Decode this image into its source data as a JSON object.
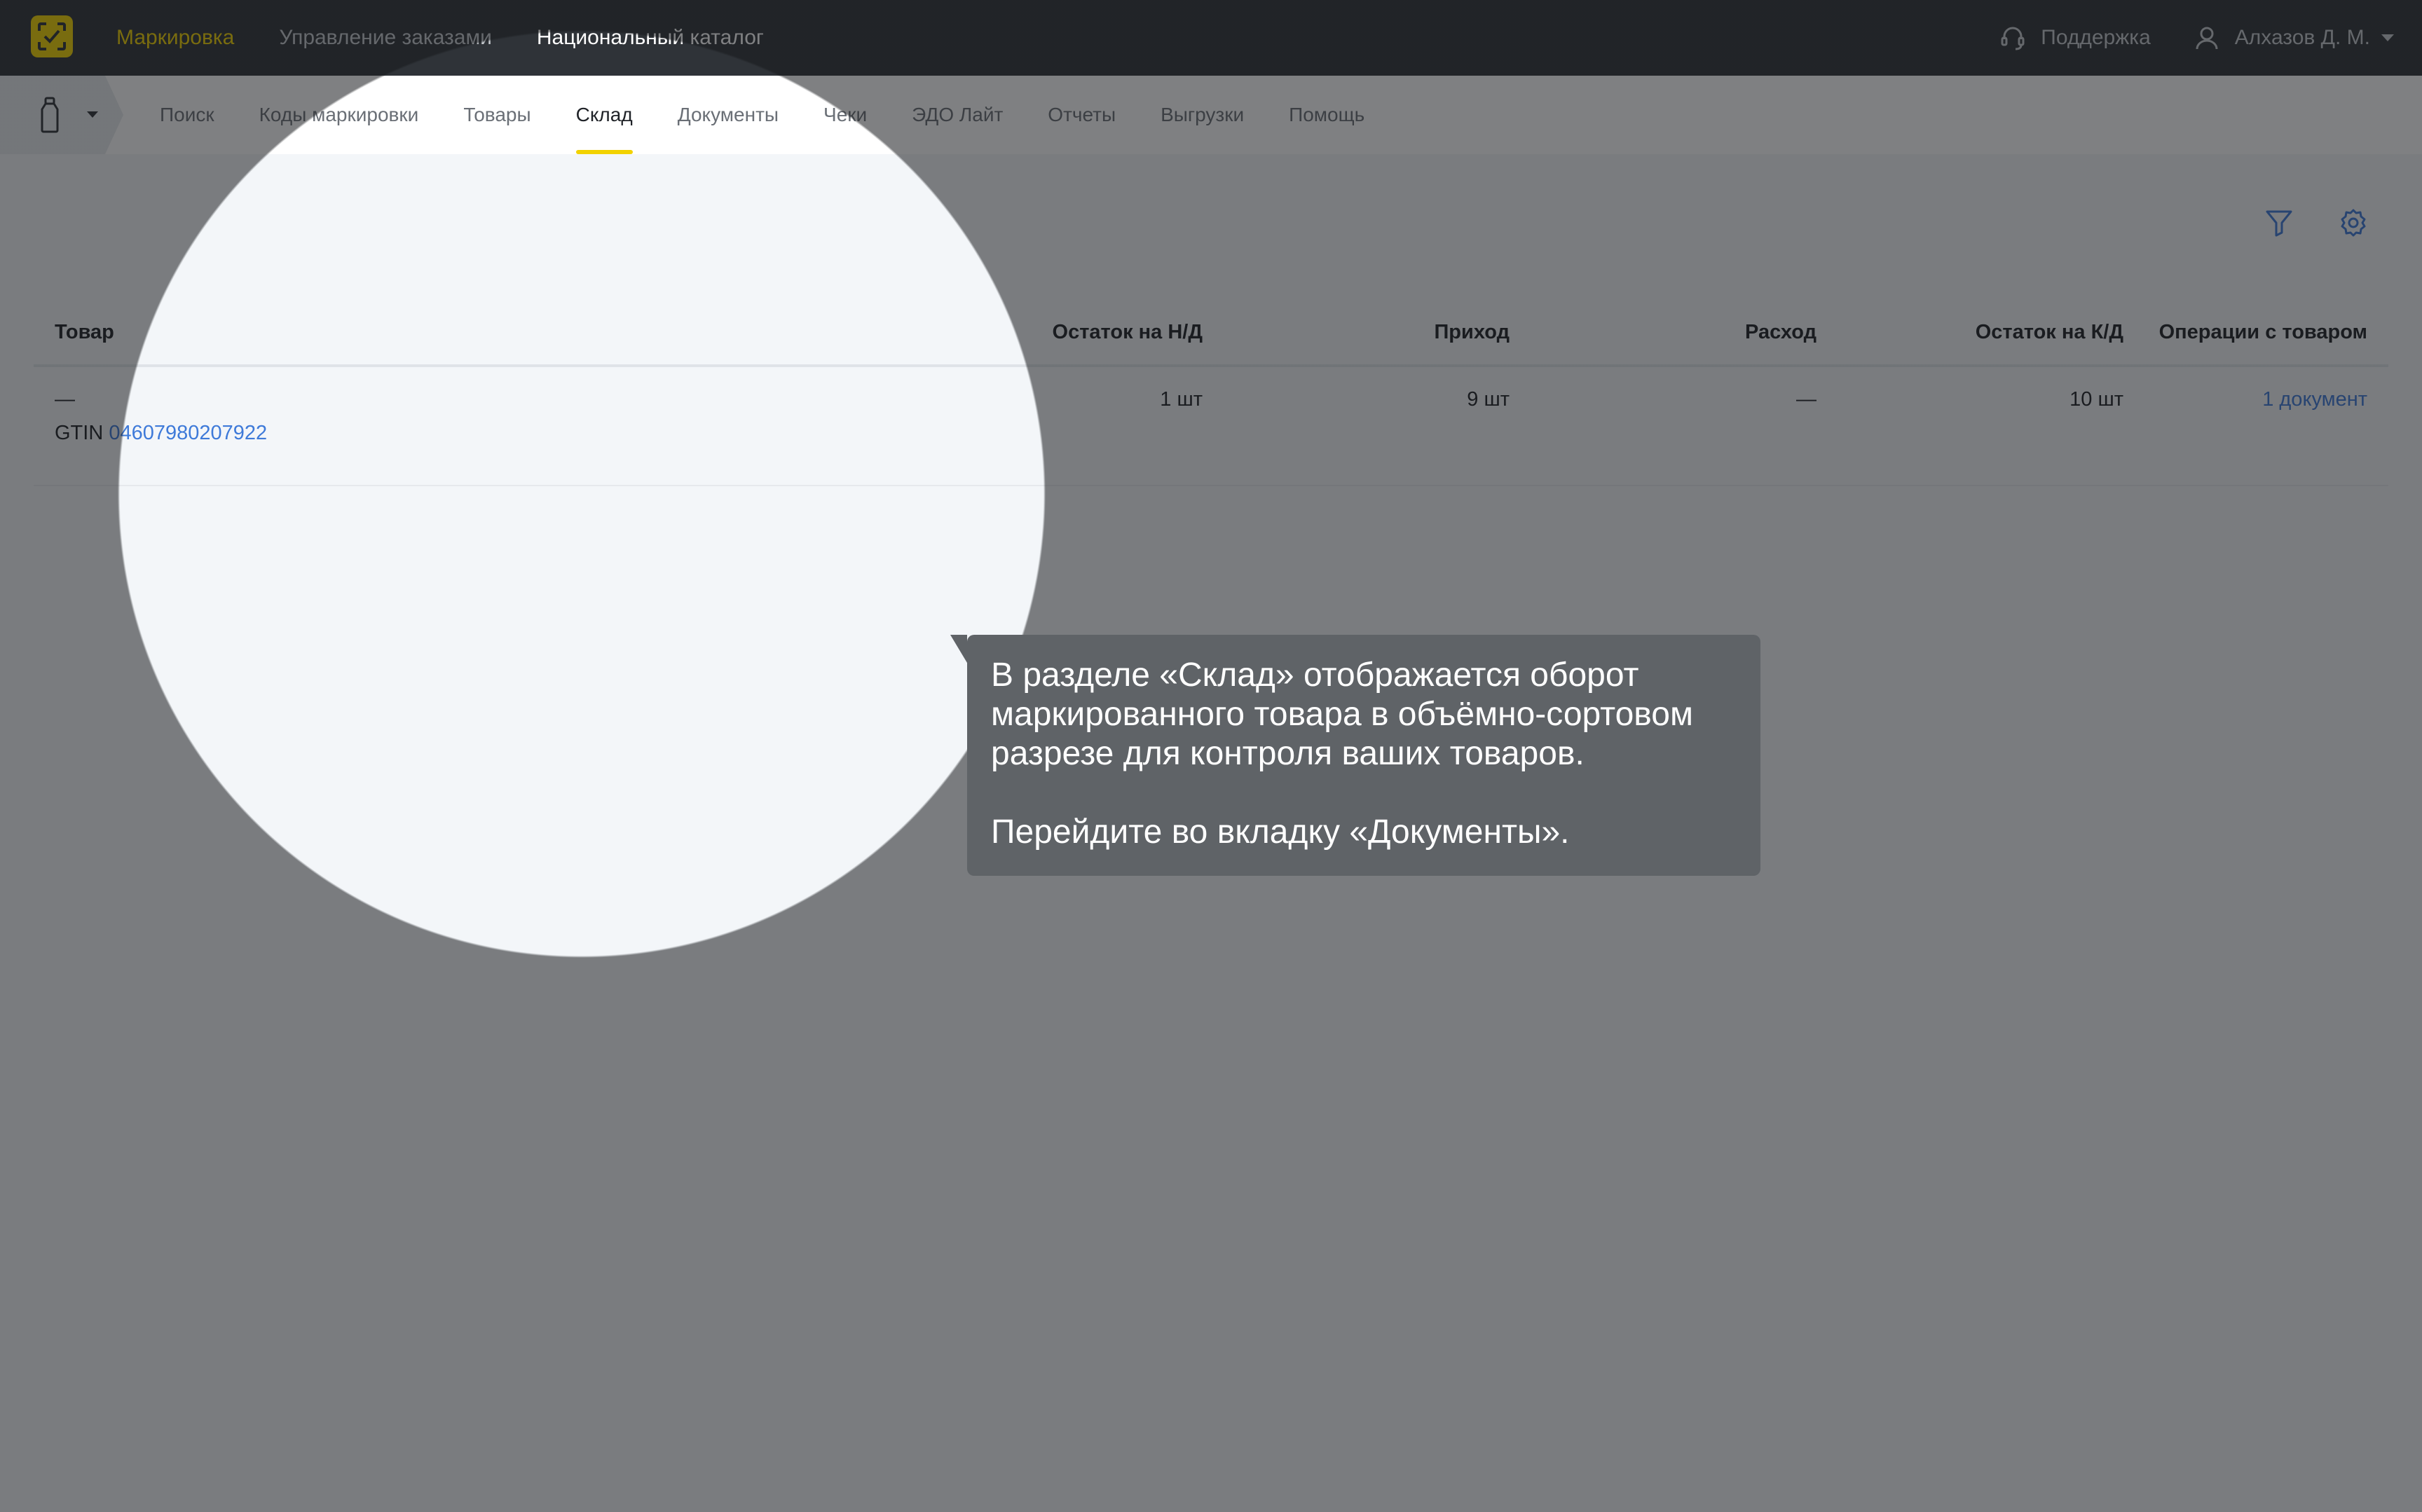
{
  "topbar": {
    "nav": [
      {
        "label": "Маркировка",
        "state": "active"
      },
      {
        "label": "Управление заказами",
        "state": "muted"
      },
      {
        "label": "Национальный каталог",
        "state": "bright"
      }
    ],
    "support_label": "Поддержка",
    "user_label": "Алхазов Д. М."
  },
  "subnav": {
    "tabs": [
      {
        "label": "Поиск"
      },
      {
        "label": "Коды маркировки"
      },
      {
        "label": "Товары"
      },
      {
        "label": "Склад"
      },
      {
        "label": "Документы"
      },
      {
        "label": "Чеки"
      },
      {
        "label": "ЭДО Лайт"
      },
      {
        "label": "Отчеты"
      },
      {
        "label": "Выгрузки"
      },
      {
        "label": "Помощь"
      }
    ],
    "active_tab": "Склад"
  },
  "table": {
    "headers": {
      "product": "Товар",
      "start_balance": "Остаток на Н/Д",
      "income": "Приход",
      "expense": "Расход",
      "end_balance": "Остаток на К/Д",
      "operations": "Операции с товаром"
    },
    "rows": [
      {
        "name": "—",
        "gtin_prefix": "GTIN",
        "gtin": "04607980207922",
        "start_balance": "1 шт",
        "income": "9 шт",
        "expense": "—",
        "end_balance": "10 шт",
        "operations": "1 документ"
      }
    ]
  },
  "tooltip": {
    "line1": "В разделе «Склад» отображается оборот",
    "line2": "маркированного товара в объёмно-сортовом",
    "line3": "разрезе для контроля ваших товаров.",
    "line4": "Перейдите во вкладку «Документы»."
  },
  "colors": {
    "accent": "#f2d200",
    "topbar_bg": "#2f3338",
    "link": "#3e7ad9",
    "tooltip_bg": "#5f6367"
  }
}
